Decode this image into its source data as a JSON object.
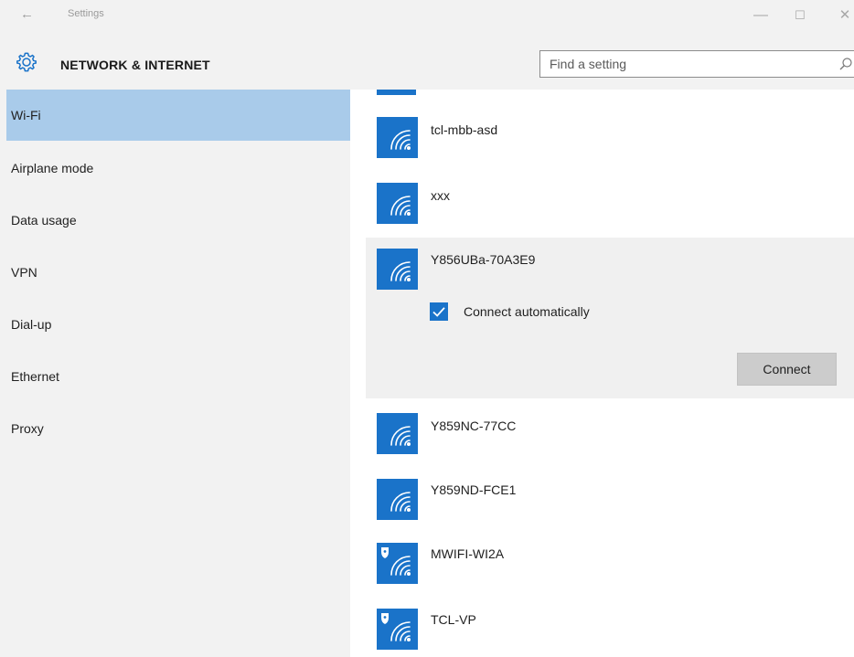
{
  "window": {
    "title": "Settings",
    "back_glyph": "←",
    "minimize_glyph": "—",
    "maximize_glyph": "☐",
    "close_glyph": "✕"
  },
  "header": {
    "title": "NETWORK & INTERNET",
    "icon": "gear-icon",
    "search_placeholder": "Find a setting",
    "search_icon": "search-icon"
  },
  "sidebar": {
    "items": [
      {
        "label": "Wi-Fi",
        "selected": true
      },
      {
        "label": "Airplane mode",
        "selected": false
      },
      {
        "label": "Data usage",
        "selected": false
      },
      {
        "label": "VPN",
        "selected": false
      },
      {
        "label": "Dial-up",
        "selected": false
      },
      {
        "label": "Ethernet",
        "selected": false
      },
      {
        "label": "Proxy",
        "selected": false
      }
    ]
  },
  "networks": [
    {
      "name": "tcl-mbb-asd",
      "secured": false
    },
    {
      "name": "xxx",
      "secured": false
    },
    {
      "name": "Y856UBa-70A3E9",
      "secured": false,
      "expanded": true,
      "connect_automatically_label": "Connect automatically",
      "connect_automatically_checked": true,
      "connect_button_label": "Connect"
    },
    {
      "name": "Y859NC-77CC",
      "secured": false
    },
    {
      "name": "Y859ND-FCE1",
      "secured": false
    },
    {
      "name": "MWIFI-WI2A",
      "secured": true
    },
    {
      "name": "TCL-VP",
      "secured": true
    }
  ],
  "colors": {
    "accent": "#1a73c9",
    "selected_nav": "#a9cbea",
    "chrome_bg": "#f2f2f2",
    "expanded_bg": "#f0f0f0",
    "button_bg": "#cccccc"
  }
}
